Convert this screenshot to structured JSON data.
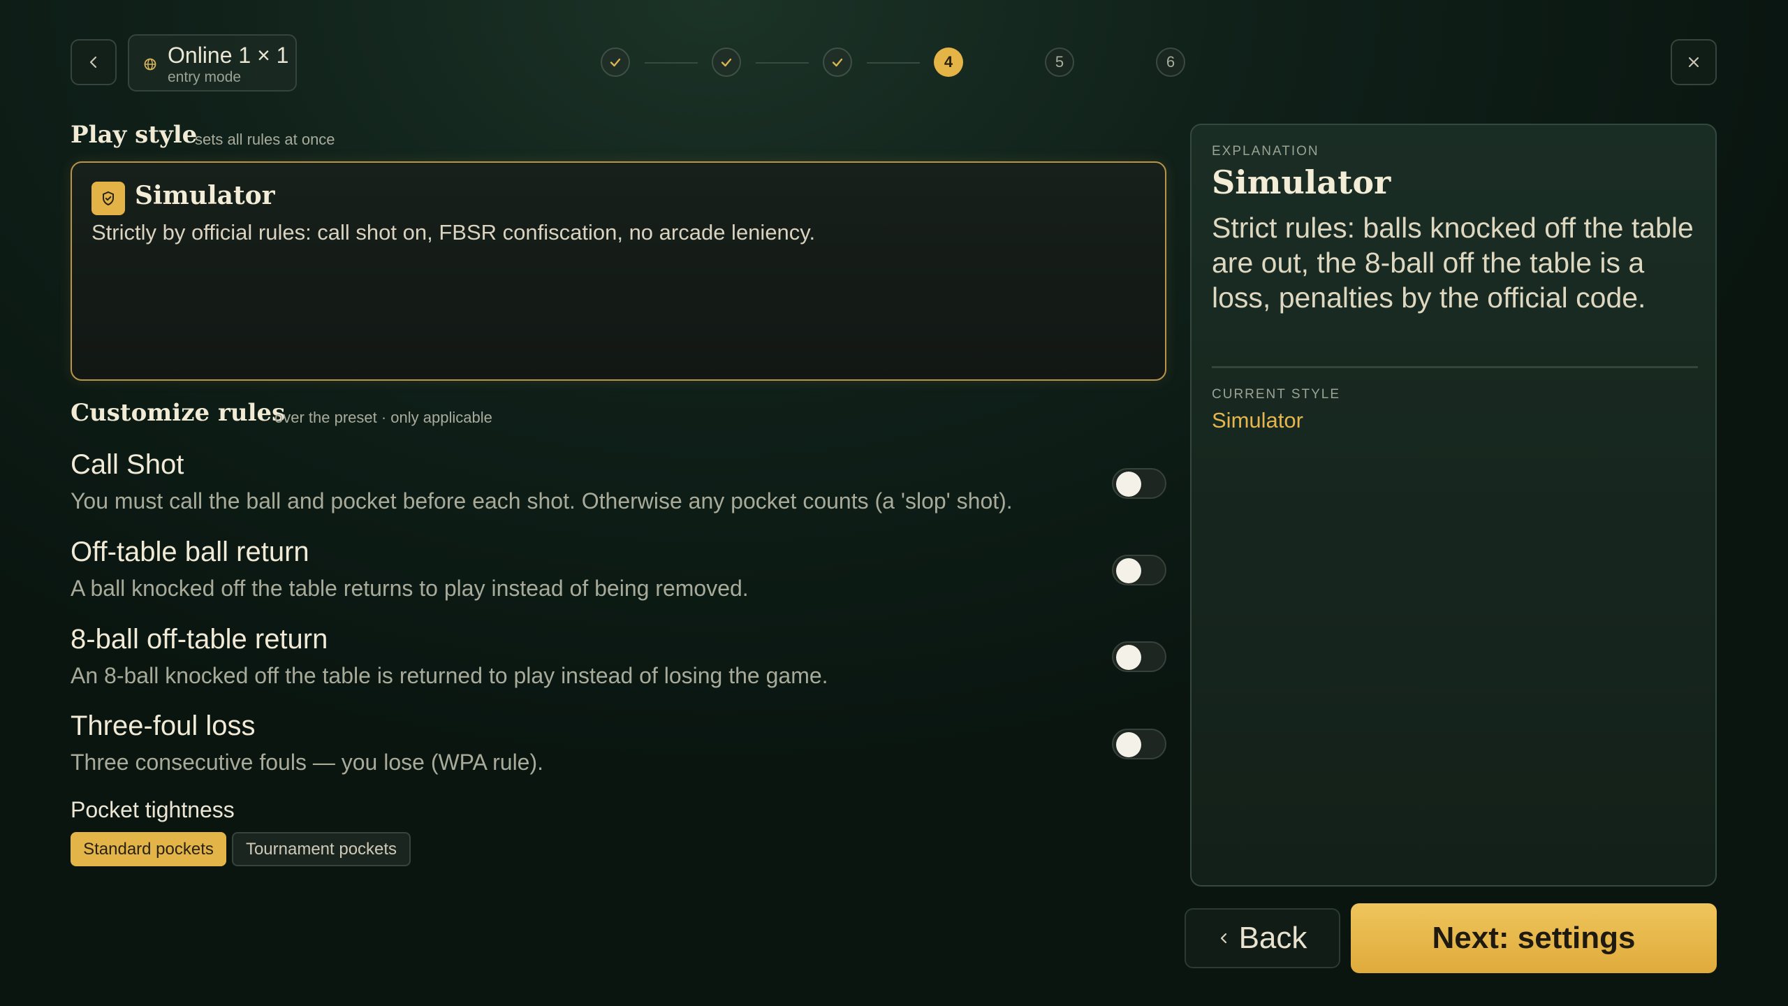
{
  "header": {
    "mode_title": "Online 1 × 1",
    "mode_subtitle": "entry mode",
    "steps": [
      {
        "label": "",
        "state": "done"
      },
      {
        "label": "",
        "state": "done"
      },
      {
        "label": "",
        "state": "done"
      },
      {
        "label": "4",
        "state": "active"
      },
      {
        "label": "5",
        "state": "todo"
      },
      {
        "label": "6",
        "state": "todo"
      }
    ]
  },
  "play_style": {
    "title": "Play style",
    "hint": "sets all rules at once",
    "preset": {
      "name": "Simulator",
      "description": "Strictly by official rules: call shot on, FBSR confiscation, no arcade leniency.",
      "icon": "shield-icon"
    }
  },
  "customize": {
    "title": "Customize rules",
    "hint": "over the preset · only applicable",
    "rules": [
      {
        "title": "Call Shot",
        "description": "You must call the ball and pocket before each shot. Otherwise any pocket counts (a 'slop' shot).",
        "enabled": false
      },
      {
        "title": "Off-table ball return",
        "description": "A ball knocked off the table returns to play instead of being removed.",
        "enabled": false
      },
      {
        "title": "8-ball off-table return",
        "description": "An 8-ball knocked off the table is returned to play instead of losing the game.",
        "enabled": false
      },
      {
        "title": "Three-foul loss",
        "description": "Three consecutive fouls — you lose (WPA rule).",
        "enabled": false
      }
    ],
    "pocket_tightness": {
      "label": "Pocket tightness",
      "options": [
        "Standard pockets",
        "Tournament pockets"
      ],
      "selected": "Standard pockets"
    }
  },
  "explanation": {
    "kicker": "EXPLANATION",
    "title": "Simulator",
    "body": "Strict rules: balls knocked off the table are out, the 8-ball off the table is a loss, penalties by the official code.",
    "current_kicker": "CURRENT STYLE",
    "current_value": "Simulator"
  },
  "footer": {
    "back_label": "Back",
    "next_label": "Next: settings"
  },
  "colors": {
    "accent": "#e4b348",
    "background": "#10211a"
  }
}
